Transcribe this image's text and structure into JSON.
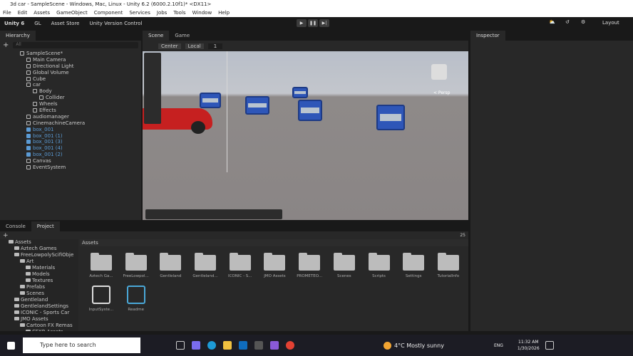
{
  "window": {
    "title": "3d car - SampleScene - Windows, Mac, Linux - Unity 6.2 (6000.2.10f1)* <DX11>"
  },
  "menu": [
    "File",
    "Edit",
    "Assets",
    "GameObject",
    "Component",
    "Services",
    "Jobs",
    "Tools",
    "Window",
    "Help"
  ],
  "toolbar": {
    "account": "Unity 6",
    "gl": "GL",
    "asset_store": "Asset Store",
    "version_control": "Unity Version Control",
    "layout": "Layout"
  },
  "hierarchy": {
    "tab": "Hierarchy",
    "search_placeholder": "All",
    "items": [
      {
        "label": "SampleScene*",
        "depth": 0,
        "selected": false
      },
      {
        "label": "Main Camera",
        "depth": 1,
        "selected": false
      },
      {
        "label": "Directional Light",
        "depth": 1,
        "selected": false
      },
      {
        "label": "Global Volume",
        "depth": 1,
        "selected": false
      },
      {
        "label": "Cube",
        "depth": 1,
        "selected": false
      },
      {
        "label": "car",
        "depth": 1,
        "selected": false
      },
      {
        "label": "Body",
        "depth": 2,
        "selected": false
      },
      {
        "label": "Collider",
        "depth": 3,
        "selected": false
      },
      {
        "label": "Wheels",
        "depth": 2,
        "selected": false
      },
      {
        "label": "Effects",
        "depth": 2,
        "selected": false
      },
      {
        "label": "audiomanager",
        "depth": 1,
        "selected": false
      },
      {
        "label": "CinemachineCamera",
        "depth": 1,
        "selected": false
      },
      {
        "label": "box_001",
        "depth": 1,
        "selected": true
      },
      {
        "label": "box_001 (1)",
        "depth": 1,
        "selected": true
      },
      {
        "label": "box_001 (3)",
        "depth": 1,
        "selected": true
      },
      {
        "label": "box_001 (4)",
        "depth": 1,
        "selected": true
      },
      {
        "label": "box_001 (2)",
        "depth": 1,
        "selected": true
      },
      {
        "label": "Canvas",
        "depth": 1,
        "selected": false
      },
      {
        "label": "EventSystem",
        "depth": 1,
        "selected": false
      }
    ]
  },
  "scene": {
    "tabs": [
      "Scene",
      "Game"
    ],
    "pivot": "Center",
    "space": "Local",
    "grid_value": "1",
    "view_label": "< Persp"
  },
  "inspector": {
    "tab": "Inspector"
  },
  "bottom": {
    "tabs": [
      "Console",
      "Project"
    ],
    "breadcrumb": "Assets",
    "count": "25",
    "tree": [
      {
        "label": "Assets",
        "depth": 0
      },
      {
        "label": "Aztech Games",
        "depth": 1
      },
      {
        "label": "FreeLowpolyScifiObje",
        "depth": 1
      },
      {
        "label": "Art",
        "depth": 2
      },
      {
        "label": "Materials",
        "depth": 3
      },
      {
        "label": "Models",
        "depth": 3
      },
      {
        "label": "Textures",
        "depth": 3
      },
      {
        "label": "Prefabs",
        "depth": 2
      },
      {
        "label": "Scenes",
        "depth": 2
      },
      {
        "label": "Gentleland",
        "depth": 1
      },
      {
        "label": "GentlelandSettings",
        "depth": 1
      },
      {
        "label": "ICONIC - Sports Car",
        "depth": 1
      },
      {
        "label": "JMO Assets",
        "depth": 1
      },
      {
        "label": "Cartoon FX Remas",
        "depth": 2
      },
      {
        "label": "CFXR Assets",
        "depth": 3
      }
    ],
    "folders": [
      "Aztech Ga...",
      "FreeLowpol...",
      "Gentleland",
      "Gentleland...",
      "ICONIC - S...",
      "JMO Assets",
      "PROMETEO...",
      "Scenes",
      "Scripts",
      "Settings",
      "TutorialInfo"
    ],
    "files": [
      "InputSyste...",
      "Readme"
    ]
  },
  "taskbar": {
    "search_placeholder": "Type here to search",
    "weather": "4°C  Mostly sunny",
    "lang": "ENG",
    "time": "11:32 AM",
    "date": "1/30/2026"
  }
}
